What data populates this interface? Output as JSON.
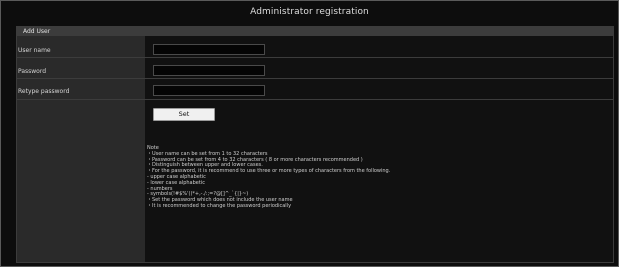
{
  "header": {
    "title": "Administrator registration"
  },
  "section": {
    "title": "Add User"
  },
  "form": {
    "user_name_label": "User name",
    "password_label": "Password",
    "retype_password_label": "Retype password",
    "user_name_value": "",
    "password_value": "",
    "retype_password_value": "",
    "set_label": "Set"
  },
  "note": {
    "title": "Note",
    "lines": [
      "・User name can be set from 1 to 32 characters",
      "・Password can be set from 4 to 32 characters ( 8 or more characters recommended )",
      "・Distinguish between upper and lower cases.",
      "・For the password, it is recommend to use three or more types of characters from the following.",
      "  - upper case alphabetic",
      "  - lower case alphabetic",
      "  - numbers",
      "  - symbols(!#$%'()*+,-./:;=?@[]^_`{|}~)",
      "・Set the password which does not include the user name",
      "・It is recommended to change the password periodically"
    ]
  }
}
